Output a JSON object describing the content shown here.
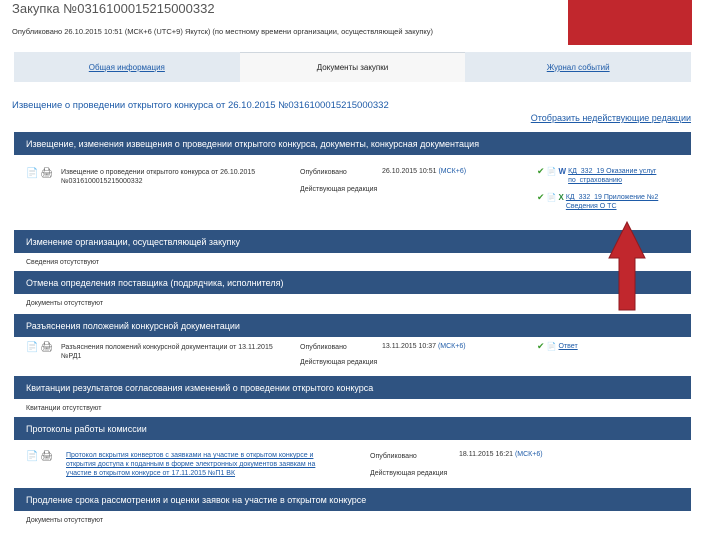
{
  "header": {
    "title": "Закупка №0316100015215000332",
    "published_line": "Опубликовано 26.10.2015 10:51 (МСК+6 (UTC+9) Якутск) (по местному времени организации, осуществляющей закупку)"
  },
  "tabs": [
    {
      "label": "Общая информация",
      "active": false
    },
    {
      "label": "Документы закупки",
      "active": true
    },
    {
      "label": "Журнал событий",
      "active": false
    }
  ],
  "notice_title": "Извещение о проведении открытого конкурса от 26.10.2015 №0316100015215000332",
  "show_invalid_link": "Отобразить недействующие редакции",
  "sections": [
    {
      "title": "Извещение, изменения извещения о проведении открытого конкурса, документы, конкурсная документация"
    },
    {
      "title": "Изменение организации, осуществляющей закупку"
    },
    {
      "title": "Отмена определения поставщика (подрядчика, исполнителя)"
    },
    {
      "title": "Разъяснения положений конкурсной документации"
    },
    {
      "title": "Квитанции результатов согласования изменений о проведении открытого конкурса"
    },
    {
      "title": "Протоколы работы комиссии"
    },
    {
      "title": "Продление срока рассмотрения и оценки заявок на участие в открытом конкурсе"
    }
  ],
  "doc1": {
    "desc_line1": "Извещение о проведении открытого конкурса от 26.10.2015",
    "desc_line2": "№0316100015215000332",
    "status1": "Опубликовано",
    "status2": "Действующая редакция",
    "date": "26.10.2015 10:51",
    "tz": "(МСК+6)",
    "attachments": [
      {
        "line1": "КД_332_19 Оказание услуг",
        "line2": "по_страхованию"
      },
      {
        "line1": "КД_332_19 Приложение №2",
        "line2": "Сведения О ТС"
      }
    ]
  },
  "empty_changes": "Сведения отсутствуют",
  "empty_cancel": "Документы отсутствуют",
  "doc2": {
    "desc_line1": "Разъяснения положений конкурсной документации от 13.11.2015",
    "desc_line2": "№РД1",
    "status1": "Опубликовано",
    "status2": "Действующая редакция",
    "date": "13.11.2015 10:37",
    "tz": "(МСК+6)",
    "attachment": "Ответ"
  },
  "empty_receipts": "Квитанции отсутствуют",
  "doc3": {
    "desc_line1": "Протокол вскрытия конвертов с заявками на участие в открытом конкурсе и",
    "desc_line2": "открытия доступа к поданным в форме электронных документов заявкам на",
    "desc_line3": "участие в открытом конкурсе от 17.11.2015 №П1 ВК",
    "status1": "Опубликовано",
    "status2": "Действующая редакция",
    "date": "18.11.2015 16:21",
    "tz": "(МСК+6)"
  },
  "empty_extension": "Документы отсутствуют",
  "colors": {
    "section_header": "#2f5381",
    "link": "#1e5ba8",
    "banner": "#c1272d",
    "arrow": "#c1272d"
  }
}
